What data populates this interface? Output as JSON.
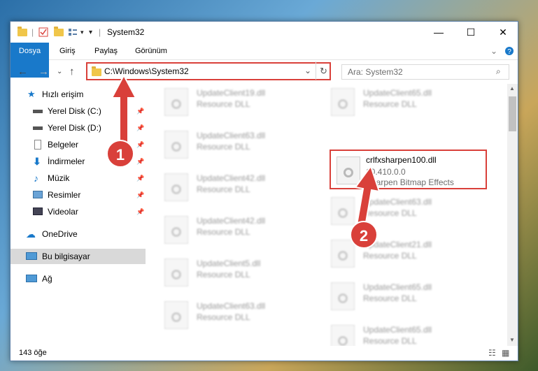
{
  "window": {
    "title": "System32"
  },
  "ribbon": {
    "tabs": [
      "Dosya",
      "Giriş",
      "Paylaş",
      "Görünüm"
    ]
  },
  "address": {
    "path": "C:\\Windows\\System32"
  },
  "search": {
    "placeholder": "Ara: System32"
  },
  "sidebar": {
    "items": [
      {
        "label": "Hızlı erişim",
        "icon": "star-icon"
      },
      {
        "label": "Yerel Disk (C:)",
        "icon": "drive-icon",
        "pinned": true
      },
      {
        "label": "Yerel Disk (D:)",
        "icon": "drive-icon",
        "pinned": true
      },
      {
        "label": "Belgeler",
        "icon": "document-icon",
        "pinned": true
      },
      {
        "label": "İndirmeler",
        "icon": "download-icon",
        "pinned": true
      },
      {
        "label": "Müzik",
        "icon": "music-icon",
        "pinned": true
      },
      {
        "label": "Resimler",
        "icon": "pictures-icon",
        "pinned": true
      },
      {
        "label": "Videolar",
        "icon": "video-icon",
        "pinned": true
      },
      {
        "label": "OneDrive",
        "icon": "cloud-icon"
      },
      {
        "label": "Bu bilgisayar",
        "icon": "computer-icon",
        "selected": true
      },
      {
        "label": "Ağ",
        "icon": "network-icon"
      }
    ]
  },
  "files": {
    "left": [
      {
        "name": "UpdateClient19.dll",
        "desc": "Resource DLL"
      },
      {
        "name": "UpdateClient63.dll",
        "desc": "Resource DLL"
      },
      {
        "name": "UpdateClient42.dll",
        "desc": "Resource DLL"
      },
      {
        "name": "UpdateClient42.dll",
        "desc": "Resource DLL"
      },
      {
        "name": "UpdateClient5.dll",
        "desc": "Resource DLL"
      },
      {
        "name": "UpdateClient63.dll",
        "desc": "Resource DLL"
      }
    ],
    "right": [
      {
        "name": "UpdateClient65.dll",
        "desc": "Resource DLL"
      },
      {
        "name": "UpdateClient63.dll",
        "desc": "Resource DLL"
      },
      {
        "name": "UpdateClient21.dll",
        "desc": "Resource DLL"
      },
      {
        "name": "UpdateClient65.dll",
        "desc": "Resource DLL"
      },
      {
        "name": "UpdateClient65.dll",
        "desc": "Resource DLL"
      }
    ],
    "highlighted": {
      "name": "crlfxsharpen100.dll",
      "version": "10.410.0.0",
      "desc": "Sharpen Bitmap Effects"
    }
  },
  "status": {
    "count": "143 öğe"
  },
  "annotations": {
    "step1": "1",
    "step2": "2"
  },
  "colors": {
    "accent": "#1979ca",
    "highlight": "#d9403a"
  }
}
